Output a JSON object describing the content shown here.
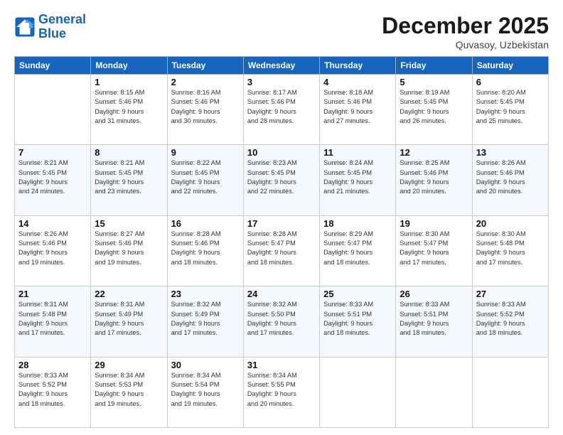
{
  "header": {
    "logo_line1": "General",
    "logo_line2": "Blue",
    "month": "December 2025",
    "location": "Quvasoy, Uzbekistan"
  },
  "days_of_week": [
    "Sunday",
    "Monday",
    "Tuesday",
    "Wednesday",
    "Thursday",
    "Friday",
    "Saturday"
  ],
  "weeks": [
    [
      {
        "num": "",
        "detail": ""
      },
      {
        "num": "1",
        "detail": "Sunrise: 8:15 AM\nSunset: 5:46 PM\nDaylight: 9 hours\nand 31 minutes."
      },
      {
        "num": "2",
        "detail": "Sunrise: 8:16 AM\nSunset: 5:46 PM\nDaylight: 9 hours\nand 30 minutes."
      },
      {
        "num": "3",
        "detail": "Sunrise: 8:17 AM\nSunset: 5:46 PM\nDaylight: 9 hours\nand 28 minutes."
      },
      {
        "num": "4",
        "detail": "Sunrise: 8:18 AM\nSunset: 5:46 PM\nDaylight: 9 hours\nand 27 minutes."
      },
      {
        "num": "5",
        "detail": "Sunrise: 8:19 AM\nSunset: 5:45 PM\nDaylight: 9 hours\nand 26 minutes."
      },
      {
        "num": "6",
        "detail": "Sunrise: 8:20 AM\nSunset: 5:45 PM\nDaylight: 9 hours\nand 25 minutes."
      }
    ],
    [
      {
        "num": "7",
        "detail": "Sunrise: 8:21 AM\nSunset: 5:45 PM\nDaylight: 9 hours\nand 24 minutes."
      },
      {
        "num": "8",
        "detail": "Sunrise: 8:21 AM\nSunset: 5:45 PM\nDaylight: 9 hours\nand 23 minutes."
      },
      {
        "num": "9",
        "detail": "Sunrise: 8:22 AM\nSunset: 5:45 PM\nDaylight: 9 hours\nand 22 minutes."
      },
      {
        "num": "10",
        "detail": "Sunrise: 8:23 AM\nSunset: 5:45 PM\nDaylight: 9 hours\nand 22 minutes."
      },
      {
        "num": "11",
        "detail": "Sunrise: 8:24 AM\nSunset: 5:45 PM\nDaylight: 9 hours\nand 21 minutes."
      },
      {
        "num": "12",
        "detail": "Sunrise: 8:25 AM\nSunset: 5:46 PM\nDaylight: 9 hours\nand 20 minutes."
      },
      {
        "num": "13",
        "detail": "Sunrise: 8:26 AM\nSunset: 5:46 PM\nDaylight: 9 hours\nand 20 minutes."
      }
    ],
    [
      {
        "num": "14",
        "detail": "Sunrise: 8:26 AM\nSunset: 5:46 PM\nDaylight: 9 hours\nand 19 minutes."
      },
      {
        "num": "15",
        "detail": "Sunrise: 8:27 AM\nSunset: 5:46 PM\nDaylight: 9 hours\nand 19 minutes."
      },
      {
        "num": "16",
        "detail": "Sunrise: 8:28 AM\nSunset: 5:46 PM\nDaylight: 9 hours\nand 18 minutes."
      },
      {
        "num": "17",
        "detail": "Sunrise: 8:28 AM\nSunset: 5:47 PM\nDaylight: 9 hours\nand 18 minutes."
      },
      {
        "num": "18",
        "detail": "Sunrise: 8:29 AM\nSunset: 5:47 PM\nDaylight: 9 hours\nand 18 minutes."
      },
      {
        "num": "19",
        "detail": "Sunrise: 8:30 AM\nSunset: 5:47 PM\nDaylight: 9 hours\nand 17 minutes."
      },
      {
        "num": "20",
        "detail": "Sunrise: 8:30 AM\nSunset: 5:48 PM\nDaylight: 9 hours\nand 17 minutes."
      }
    ],
    [
      {
        "num": "21",
        "detail": "Sunrise: 8:31 AM\nSunset: 5:48 PM\nDaylight: 9 hours\nand 17 minutes."
      },
      {
        "num": "22",
        "detail": "Sunrise: 8:31 AM\nSunset: 5:49 PM\nDaylight: 9 hours\nand 17 minutes."
      },
      {
        "num": "23",
        "detail": "Sunrise: 8:32 AM\nSunset: 5:49 PM\nDaylight: 9 hours\nand 17 minutes."
      },
      {
        "num": "24",
        "detail": "Sunrise: 8:32 AM\nSunset: 5:50 PM\nDaylight: 9 hours\nand 17 minutes."
      },
      {
        "num": "25",
        "detail": "Sunrise: 8:33 AM\nSunset: 5:51 PM\nDaylight: 9 hours\nand 18 minutes."
      },
      {
        "num": "26",
        "detail": "Sunrise: 8:33 AM\nSunset: 5:51 PM\nDaylight: 9 hours\nand 18 minutes."
      },
      {
        "num": "27",
        "detail": "Sunrise: 8:33 AM\nSunset: 5:52 PM\nDaylight: 9 hours\nand 18 minutes."
      }
    ],
    [
      {
        "num": "28",
        "detail": "Sunrise: 8:33 AM\nSunset: 5:52 PM\nDaylight: 9 hours\nand 18 minutes."
      },
      {
        "num": "29",
        "detail": "Sunrise: 8:34 AM\nSunset: 5:53 PM\nDaylight: 9 hours\nand 19 minutes."
      },
      {
        "num": "30",
        "detail": "Sunrise: 8:34 AM\nSunset: 5:54 PM\nDaylight: 9 hours\nand 19 minutes."
      },
      {
        "num": "31",
        "detail": "Sunrise: 8:34 AM\nSunset: 5:55 PM\nDaylight: 9 hours\nand 20 minutes."
      },
      {
        "num": "",
        "detail": ""
      },
      {
        "num": "",
        "detail": ""
      },
      {
        "num": "",
        "detail": ""
      }
    ]
  ]
}
